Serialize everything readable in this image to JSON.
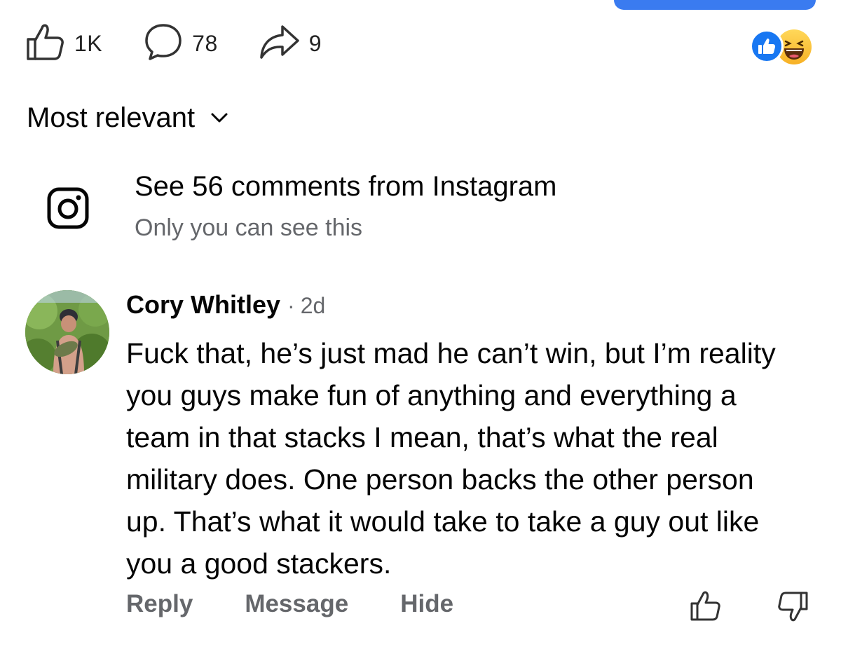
{
  "post_actions": {
    "like_count": "1K",
    "comment_count": "78",
    "share_count": "9"
  },
  "reactions": [
    "like",
    "haha"
  ],
  "sort": {
    "label": "Most relevant"
  },
  "instagram": {
    "title": "See 56 comments from Instagram",
    "subtitle": "Only you can see this"
  },
  "comment": {
    "author": "Cory Whitley",
    "separator": "·",
    "time": "2d",
    "text": "Fuck that, he’s just mad he can’t win, but I’m reality you guys make fun of anything and everything a team in that stacks I mean, that’s what the real military does. One person backs the other person up. That’s what it would take to take a guy out like you a good stackers.",
    "actions": {
      "reply": "Reply",
      "message": "Message",
      "hide": "Hide"
    }
  },
  "colors": {
    "brand_blue": "#1877f2",
    "muted_text": "#65676b",
    "primary_text": "#050505"
  }
}
